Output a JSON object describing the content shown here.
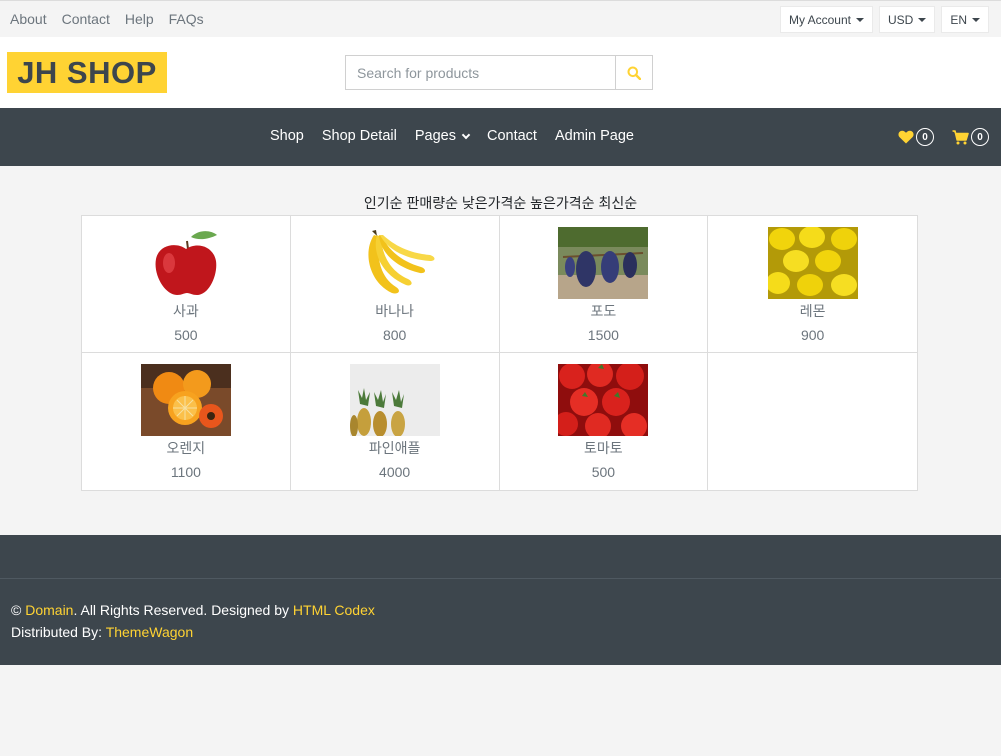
{
  "topbar": {
    "links": [
      "About",
      "Contact",
      "Help",
      "FAQs"
    ],
    "account_label": "My Account",
    "currency_label": "USD",
    "language_label": "EN"
  },
  "header": {
    "logo": "JH SHOP",
    "search_placeholder": "Search for products"
  },
  "navbar": {
    "items": [
      "Shop",
      "Shop Detail",
      "Pages",
      "Contact",
      "Admin Page"
    ],
    "wishlist_count": "0",
    "cart_count": "0"
  },
  "sort_options": [
    "인기순",
    "판매량순",
    "낮은가격순",
    "높은가격순",
    "최신순"
  ],
  "products": [
    {
      "name": "사과",
      "price": "500",
      "image": "apple"
    },
    {
      "name": "바나나",
      "price": "800",
      "image": "banana"
    },
    {
      "name": "포도",
      "price": "1500",
      "image": "grapes"
    },
    {
      "name": "레몬",
      "price": "900",
      "image": "lemons"
    },
    {
      "name": "오렌지",
      "price": "1100",
      "image": "oranges"
    },
    {
      "name": "파인애플",
      "price": "4000",
      "image": "pineapples"
    },
    {
      "name": "토마토",
      "price": "500",
      "image": "tomatoes"
    }
  ],
  "footer": {
    "copyright_symbol": "©",
    "domain_link": "Domain",
    "rights_text": ". All Rights Reserved. Designed by",
    "codex_link": "HTML Codex",
    "distributed_text": "Distributed By:",
    "themewagon_link": "ThemeWagon"
  },
  "colors": {
    "accent": "#ffd333",
    "dark": "#3d464d",
    "muted": "#6c757d",
    "background": "#f4f4f4"
  }
}
